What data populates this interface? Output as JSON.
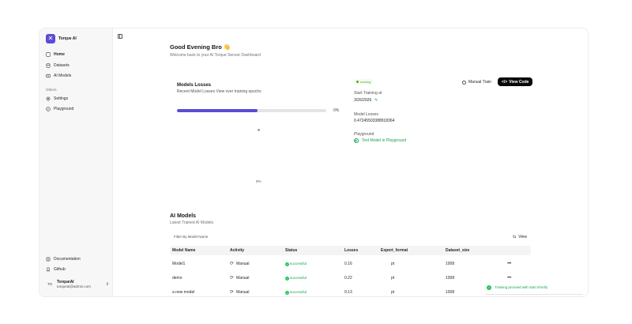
{
  "brand": {
    "name": "Torque AI"
  },
  "sidebar": {
    "items": [
      {
        "label": "Home",
        "icon": "home-icon"
      },
      {
        "label": "Datasets",
        "icon": "database-icon"
      },
      {
        "label": "AI Models",
        "icon": "cube-icon"
      }
    ],
    "others_label": "Others",
    "others": [
      {
        "label": "Settings",
        "icon": "gear-icon"
      },
      {
        "label": "Playground",
        "icon": "play-icon"
      }
    ],
    "footer": [
      {
        "label": "Documentation",
        "icon": "book-icon"
      },
      {
        "label": "Github",
        "icon": "github-icon"
      }
    ],
    "user": {
      "initials": "TO",
      "name": "TorqueAI",
      "email": "torqueai@admin.com"
    }
  },
  "header": {
    "greeting": "Good Evening Bro 👋",
    "welcome": "Welcome back to your AI Torque Sensor Dashboard"
  },
  "training": {
    "title": "Models Losses",
    "subtitle": "Recent Model Losses View over training epochs",
    "progress_fraction": 0.54,
    "progress_label": "0%",
    "chart_empty_label": "0%",
    "status": "running",
    "start_label": "Start Training at",
    "start_value": "3/26/2026",
    "losses_label": "Model Losses",
    "losses_value": "0.47245503388918364",
    "playground_label": "Playground",
    "playground_link": "Test Model in Playground",
    "manual_train": "Manual Train",
    "view_code": "View Code"
  },
  "models": {
    "title": "AI Models",
    "subtitle": "Latest Trained AI Models",
    "filter_placeholder": "Filter By Model Name",
    "view_label": "View",
    "columns": [
      "Model Name",
      "Activity",
      "Status",
      "Losses",
      "Export_format",
      "Dataset_size"
    ],
    "rows": [
      {
        "name": "Model1",
        "activity": "Manual",
        "status": "successful",
        "losses": "0.16",
        "format": "pt",
        "size": "1008"
      },
      {
        "name": "demo",
        "activity": "Manual",
        "status": "successful",
        "losses": "0.22",
        "format": "pt",
        "size": "1008"
      },
      {
        "name": "a new model",
        "activity": "Manual",
        "status": "successful",
        "losses": "0.13",
        "format": "pt",
        "size": "1008"
      }
    ]
  },
  "toast": {
    "message": "Training proceed with start shortly"
  },
  "colors": {
    "accent": "#5b4bd6",
    "success": "#16a34a",
    "sidebar_bg": "#f7f7f8"
  }
}
